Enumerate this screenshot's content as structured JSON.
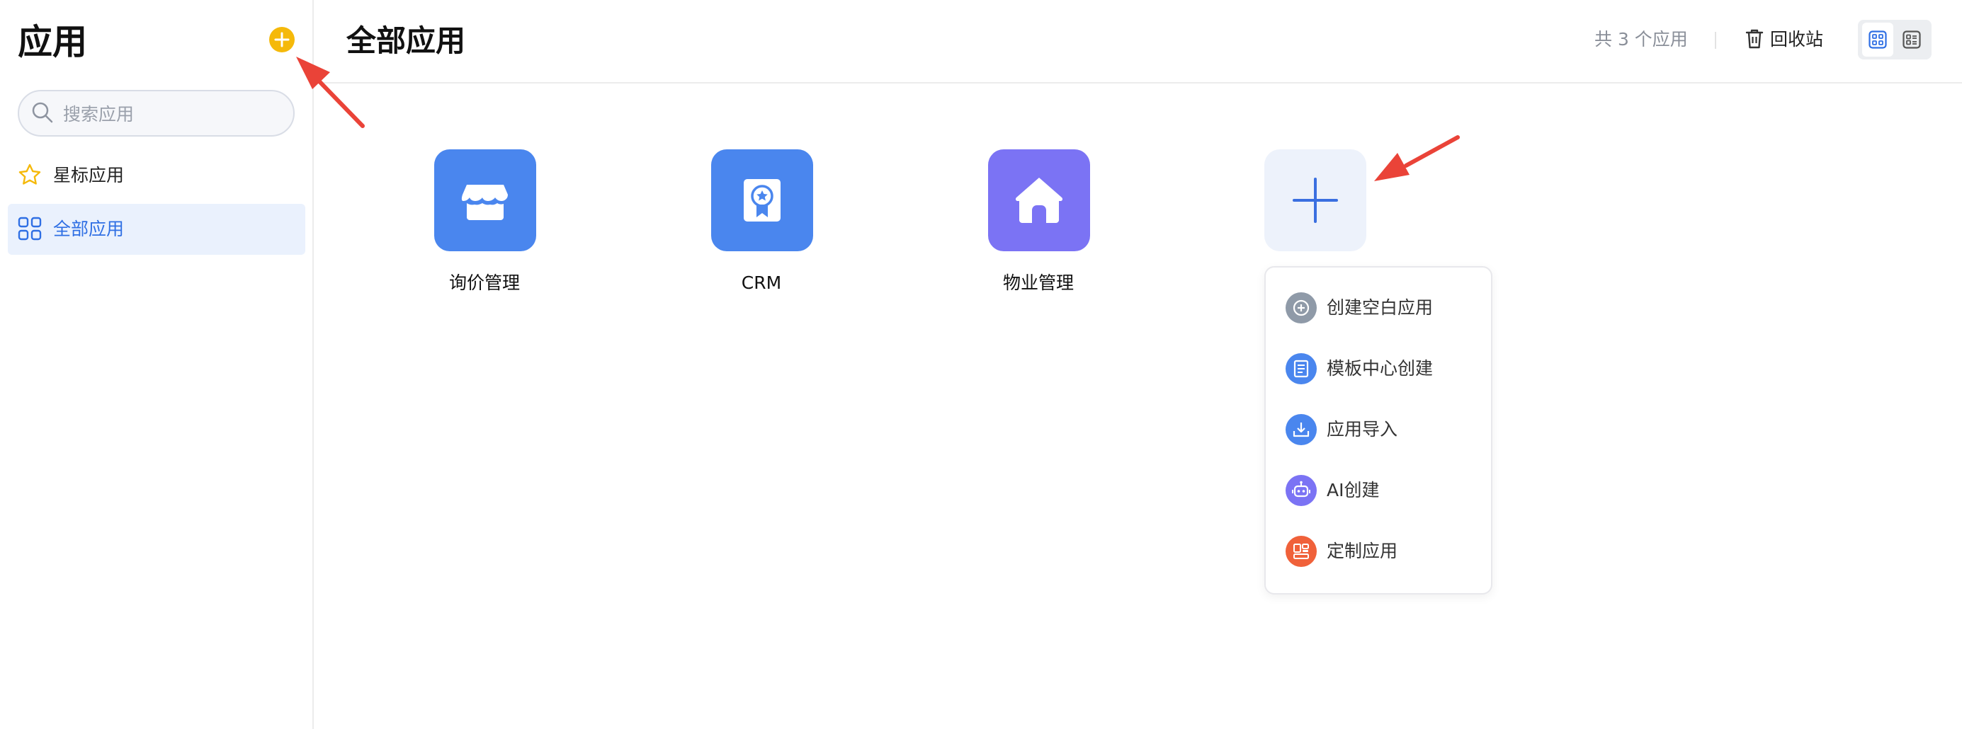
{
  "sidebar": {
    "title": "应用",
    "search_placeholder": "搜索应用",
    "items": [
      {
        "label": "星标应用",
        "icon": "star-icon",
        "active": false
      },
      {
        "label": "全部应用",
        "icon": "grid-icon",
        "active": true
      }
    ]
  },
  "header": {
    "title": "全部应用",
    "count": "共 3 个应用",
    "recycle_label": "回收站",
    "view_mode": "grid"
  },
  "apps": [
    {
      "name": "询价管理",
      "icon": "store-icon",
      "color": "#4a86ee"
    },
    {
      "name": "CRM",
      "icon": "badge-icon",
      "color": "#4a86ee"
    },
    {
      "name": "物业管理",
      "icon": "house-icon",
      "color": "#7b73f4"
    }
  ],
  "create_menu": {
    "items": [
      {
        "label": "创建空白应用",
        "icon": "plus-circle-icon",
        "color": "#8f9aa8"
      },
      {
        "label": "模板中心创建",
        "icon": "template-icon",
        "color": "#4a86ee"
      },
      {
        "label": "应用导入",
        "icon": "import-icon",
        "color": "#4a86ee"
      },
      {
        "label": "AI创建",
        "icon": "robot-icon",
        "color": "#7b73f4"
      },
      {
        "label": "定制应用",
        "icon": "custom-app-icon",
        "color": "#f0613a"
      }
    ]
  },
  "colors": {
    "accent": "#2f6fe4",
    "add_button": "#f5b90a",
    "annotation_arrow": "#ea4338"
  }
}
